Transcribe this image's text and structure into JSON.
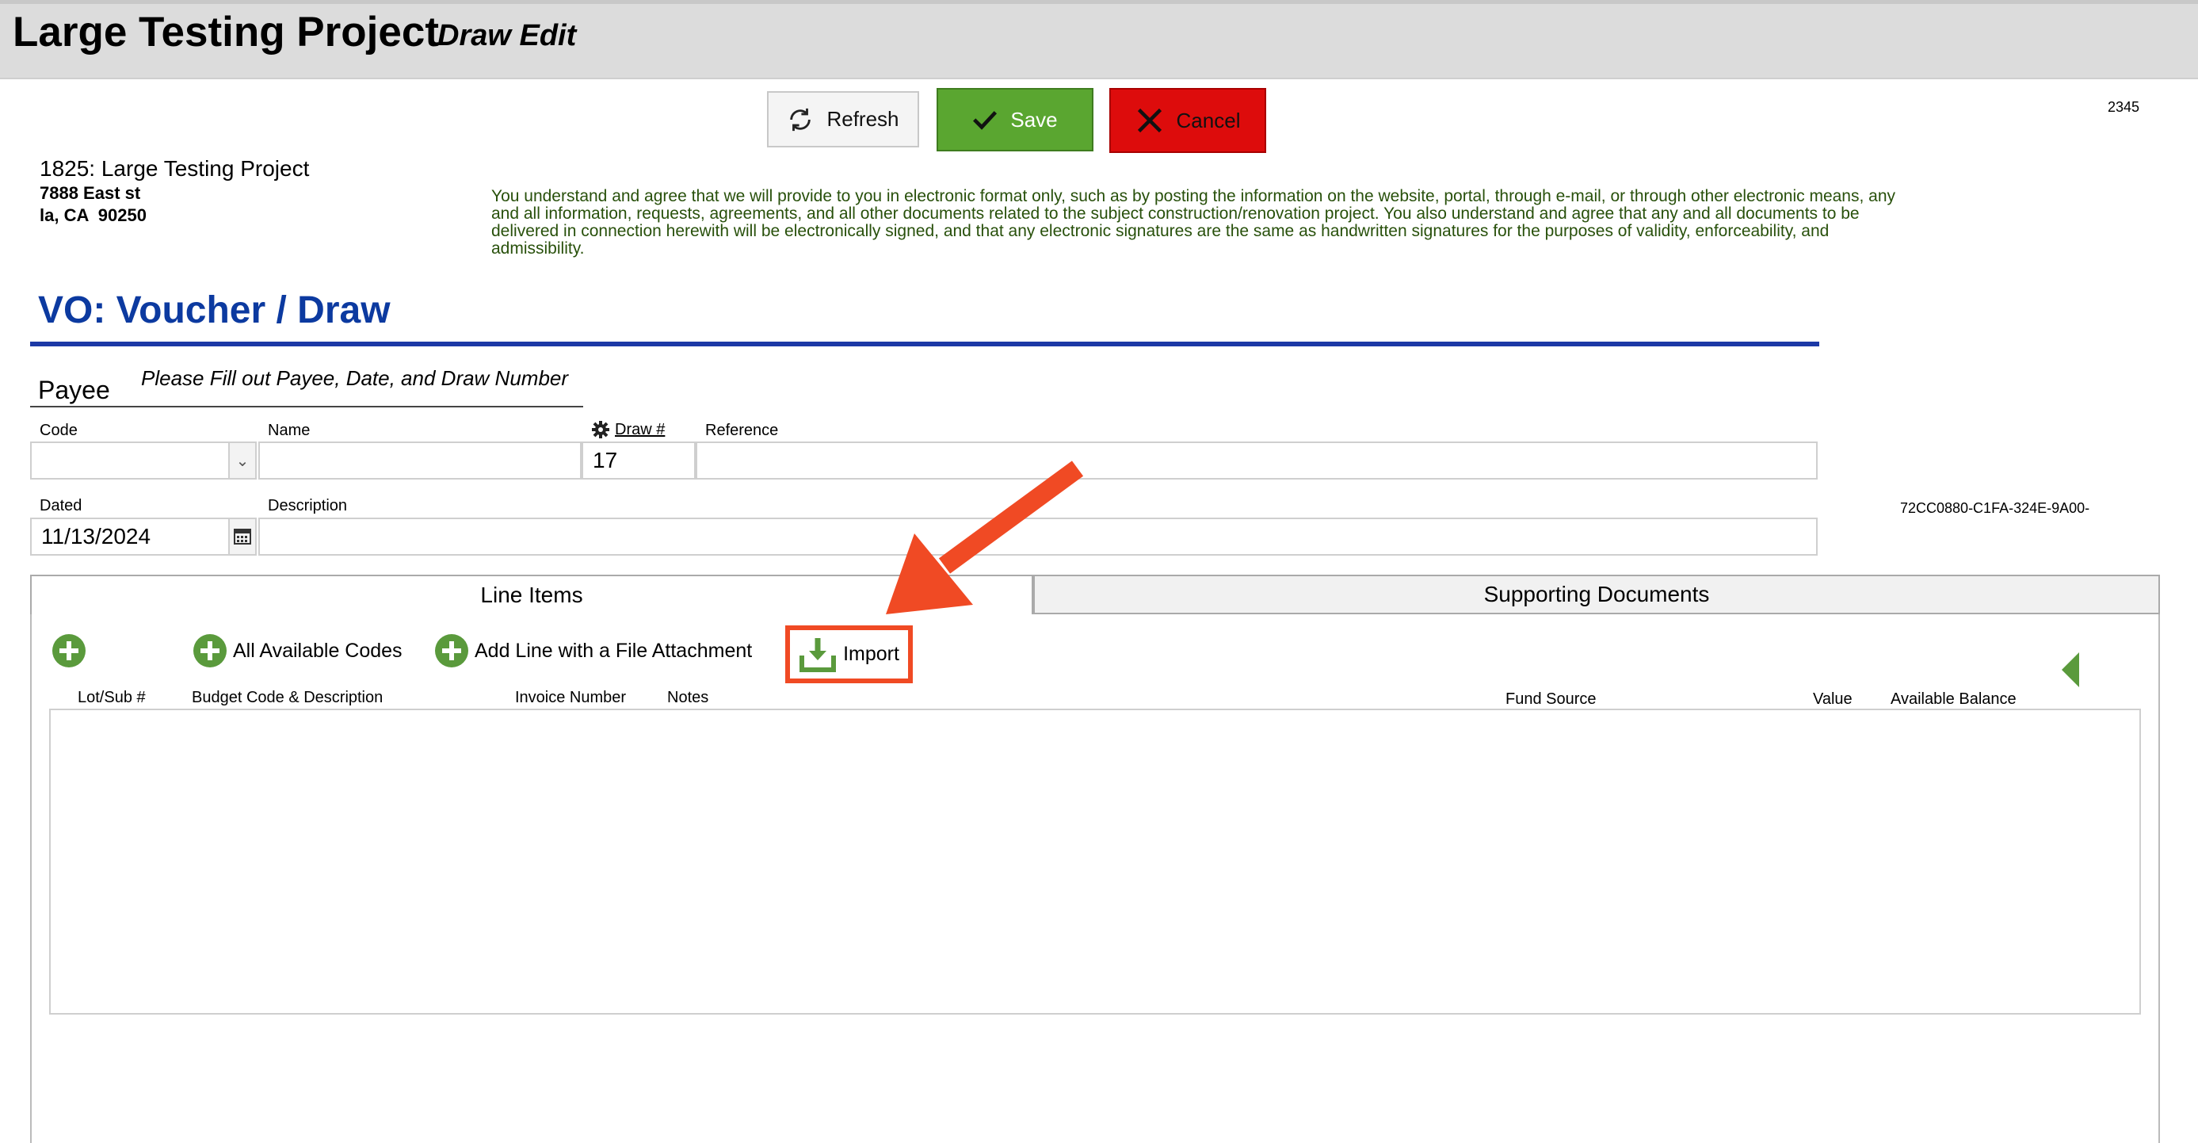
{
  "header": {
    "title": "Large Testing Project",
    "subtitle": "Draw Edit"
  },
  "toolbar": {
    "refresh_label": "Refresh",
    "save_label": "Save",
    "cancel_label": "Cancel",
    "record_number": "2345"
  },
  "project": {
    "name": "1825: Large Testing Project",
    "address_line1": "7888 East st",
    "address_line2": "la, CA  90250"
  },
  "disclaimer": "You understand and agree that we will provide to you in electronic format only, such as by posting the information on the website, portal, through e-mail, or through other electronic means, any and all information, requests, agreements, and all other documents related to the subject construction/renovation project. You also understand and agree that any and all documents to be delivered in connection herewith will be electronically signed, and that any electronic signatures are the same as handwritten signatures for the purposes of validity, enforceability, and admissibility.",
  "section_title": "VO: Voucher / Draw",
  "payee": {
    "label": "Payee",
    "hint": "Please Fill out Payee, Date, and Draw Number"
  },
  "form": {
    "code_label": "Code",
    "code_value": "",
    "name_label": "Name",
    "name_value": "",
    "draw_label": "Draw #",
    "draw_value": "17",
    "reference_label": "Reference",
    "reference_value": "",
    "dated_label": "Dated",
    "dated_value": "11/13/2024",
    "description_label": "Description",
    "description_value": ""
  },
  "guid_text": "72CC0880-C1FA-324E-9A00-",
  "tabs": {
    "line_items": "Line Items",
    "supporting_documents": "Supporting Documents"
  },
  "actions": {
    "all_codes": "All Available Codes",
    "add_line_attachment": "Add Line with a File Attachment",
    "import": "Import"
  },
  "columns": {
    "lot_sub": "Lot/Sub #",
    "budget_code": "Budget Code & Description",
    "invoice_number": "Invoice Number",
    "notes": "Notes",
    "fund_source": "Fund Source",
    "value": "Value",
    "available_balance": "Available Balance"
  },
  "colors": {
    "save": "#5aa630",
    "cancel": "#dd0c0c",
    "title_blue": "#0c3aa0",
    "highlight": "#f04a24",
    "add_green": "#5a9a3c"
  },
  "icons": [
    "refresh-icon",
    "checkmark-icon",
    "close-icon",
    "gear-icon",
    "calendar-icon",
    "chevron-down-icon",
    "add-icon",
    "import-icon",
    "collapse-arrow-icon",
    "annotation-arrow"
  ]
}
